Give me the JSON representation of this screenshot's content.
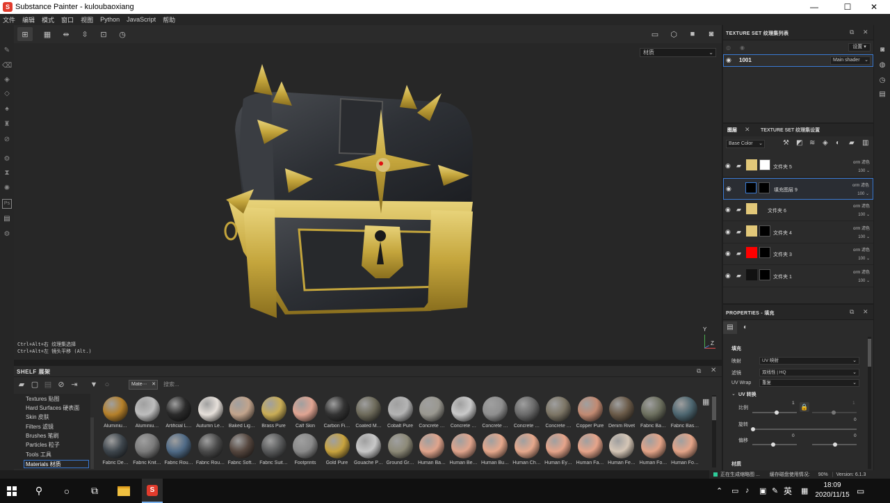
{
  "window": {
    "title": "Substance Painter - kuloubaoxiang",
    "logo": "S"
  },
  "window_controls": [
    "—",
    "☐",
    "✕"
  ],
  "menu": [
    "文件",
    "编辑",
    "模式",
    "窗口",
    "视图",
    "Python",
    "JavaScript",
    "帮助"
  ],
  "viewport": {
    "dropdown": "材质",
    "hint_line1": "Ctrl+Alt+右 纹理集选择",
    "hint_line2": "Ctrl+Alt+左 镜头平移 (Alt.)",
    "axis_y": "Y",
    "axis_z": "Z"
  },
  "shelf": {
    "title": "SHELF 展架",
    "filter_chip": "Mate⋯",
    "search_placeholder": "搜索...",
    "categories": [
      {
        "label": "Textures 贴图"
      },
      {
        "label": "Hard Surfaces 硬表面"
      },
      {
        "label": "Skin 皮肤"
      },
      {
        "label": "Filters 滤镜"
      },
      {
        "label": "Brushes 笔刷"
      },
      {
        "label": "Particles 粒子"
      },
      {
        "label": "Tools 工具"
      },
      {
        "label": "Materials 材质"
      }
    ],
    "materials_row1": [
      {
        "label": "Aluminiu…",
        "color": "#b5802a"
      },
      {
        "label": "Aluminiu…",
        "color": "#bdbdbd"
      },
      {
        "label": "Artificial L…",
        "color": "#2a2a2a"
      },
      {
        "label": "Autumn Le…",
        "color": "#e6e0da"
      },
      {
        "label": "Baked Lig…",
        "color": "#c2a48c"
      },
      {
        "label": "Brass Pure",
        "color": "#c9ad56"
      },
      {
        "label": "Calf Skin",
        "color": "#e0a492"
      },
      {
        "label": "Carbon Fi…",
        "color": "#333333"
      },
      {
        "label": "Coated M…",
        "color": "#6d6a5a"
      },
      {
        "label": "Cobalt Pure",
        "color": "#b4b4b4"
      },
      {
        "label": "Concrete …",
        "color": "#9a9890"
      },
      {
        "label": "Concrete …",
        "color": "#c9c9c9"
      },
      {
        "label": "Concrete …",
        "color": "#8f8f8f"
      },
      {
        "label": "Concrete …",
        "color": "#6a6a6a"
      },
      {
        "label": "Concrete …",
        "color": "#7c7565"
      },
      {
        "label": "Copper Pure",
        "color": "#c28a72"
      },
      {
        "label": "Denim Rivet",
        "color": "#6a5a48"
      },
      {
        "label": "Fabric Ba…",
        "color": "#6d705f"
      },
      {
        "label": "Fabric Bas…",
        "color": "#4d6670"
      }
    ],
    "materials_row2": [
      {
        "label": "Fabric De…",
        "color": "#3e464d"
      },
      {
        "label": "Fabric Knit…",
        "color": "#7b7b7b"
      },
      {
        "label": "Fabric Rou…",
        "color": "#4f6a86"
      },
      {
        "label": "Fabric Rou…",
        "color": "#4a4a4a"
      },
      {
        "label": "Fabric Soft…",
        "color": "#55463e"
      },
      {
        "label": "Fabric Suit…",
        "color": "#58595a"
      },
      {
        "label": "Footprints",
        "color": "#8a8a8a"
      },
      {
        "label": "Gold Pure",
        "color": "#c8a33e"
      },
      {
        "label": "Gouache P…",
        "color": "#c8c8c8"
      },
      {
        "label": "Ground Gr…",
        "color": "#8d8a78"
      },
      {
        "label": "Human Ba…",
        "color": "#e0a48c"
      },
      {
        "label": "Human Be…",
        "color": "#e0a48c"
      },
      {
        "label": "Human Bu…",
        "color": "#e6a88c"
      },
      {
        "label": "Human Ch…",
        "color": "#e6a88c"
      },
      {
        "label": "Human Ey…",
        "color": "#e6a48a"
      },
      {
        "label": "Human Fa…",
        "color": "#e6a48a"
      },
      {
        "label": "Human Fe…",
        "color": "#d5c6b6"
      },
      {
        "label": "Human Fo…",
        "color": "#e4a488"
      },
      {
        "label": "Human Fo…",
        "color": "#e4a488"
      }
    ]
  },
  "texture_set_list": {
    "title": "TEXTURE SET 纹理集列表",
    "settings": "设置 ▾",
    "row_name": "1001",
    "shader": "Main shader"
  },
  "layers_panel": {
    "tab_layers": "图层",
    "tab_settings": "TEXTURE SET 纹理集设置",
    "channel": "Base Color",
    "layers": [
      {
        "name": "文件夹 5",
        "blend": "orm 滤色",
        "opacity": "100 ⌄",
        "thumb1": "#e2c879",
        "thumb2": "#ffffff",
        "selected": false
      },
      {
        "name": "填充图层 9",
        "blend": "orm 滤色",
        "opacity": "100 ⌄",
        "thumb1": "#000000",
        "thumb2": "#000000",
        "selected": true
      },
      {
        "name": "文件夹 6",
        "blend": "orm 滤色",
        "opacity": "100 ⌄",
        "thumb1": "#e2c879",
        "thumb2": "",
        "selected": false
      },
      {
        "name": "文件夹 4",
        "blend": "orm 滤色",
        "opacity": "100 ⌄",
        "thumb1": "#e2c879",
        "thumb2": "#000000",
        "selected": false
      },
      {
        "name": "文件夹 3",
        "blend": "orm 滤色",
        "opacity": "100 ⌄",
        "thumb1": "#ff0000",
        "thumb2": "#000000",
        "selected": false
      },
      {
        "name": "文件夹 1",
        "blend": "orm 滤色",
        "opacity": "100 ⌄",
        "thumb1": "#111111",
        "thumb2": "#000000",
        "selected": false
      }
    ]
  },
  "properties": {
    "title": "PROPERTIES - 填充",
    "section_fill": "填充",
    "mapping_label": "映射",
    "mapping_value": "UV 映射",
    "filter_label": "滤镜",
    "filter_value": "双线性 | HQ",
    "uvwrap_label": "UV Wrap",
    "uvwrap_value": "重复",
    "uv_transform": "UV 转换",
    "scale_label": "比例",
    "scale_value": "1",
    "scale_value2": "1",
    "rotate_label": "旋转",
    "rotate_value": "0",
    "offset_label": "偏移",
    "offset_value1": "0",
    "offset_value2": "0",
    "section_material": "材质"
  },
  "status": {
    "message": "正在生成缩略图 ...",
    "disk": "缓存磁盘使用情况:",
    "percent": "90%",
    "version": "Version: 6.1.3",
    "accent": "#2ecc9a"
  },
  "taskbar": {
    "time": "18:09",
    "date": "2020/11/15",
    "lang": "英"
  }
}
